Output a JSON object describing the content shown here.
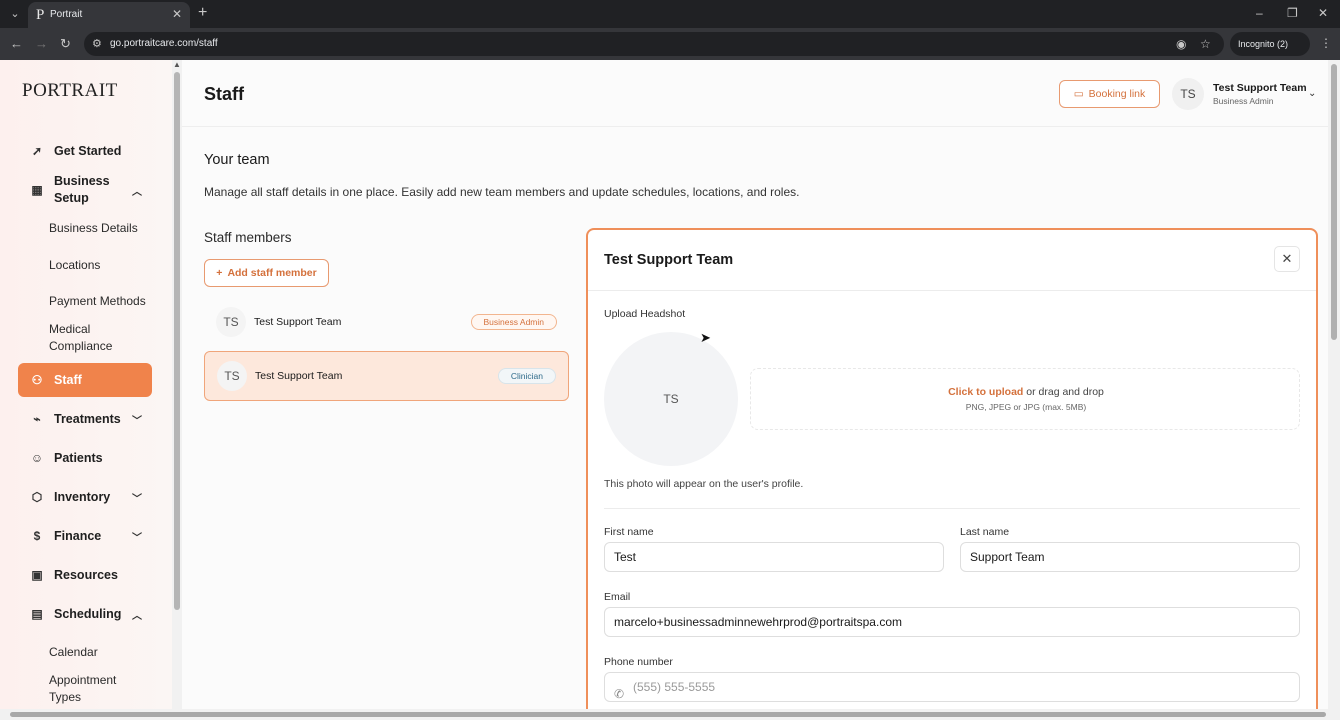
{
  "browser": {
    "tab_title": "Portrait",
    "url": "go.portraitcare.com/staff",
    "incognito_label": "Incognito (2)"
  },
  "sidebar": {
    "logo": "PORTRAIT",
    "items": [
      {
        "label": "Get Started",
        "icon": "rocket-icon"
      },
      {
        "label": "Business Setup",
        "icon": "building-icon",
        "expanded": true
      },
      {
        "label": "Business Details"
      },
      {
        "label": "Locations"
      },
      {
        "label": "Payment Methods"
      },
      {
        "label": "Medical Compliance"
      },
      {
        "label": "Staff",
        "icon": "users-icon",
        "active": true
      },
      {
        "label": "Treatments",
        "icon": "syringe-icon",
        "expanded": false
      },
      {
        "label": "Patients",
        "icon": "person-icon"
      },
      {
        "label": "Inventory",
        "icon": "box-icon",
        "expanded": false
      },
      {
        "label": "Finance",
        "icon": "dollar-icon",
        "expanded": false
      },
      {
        "label": "Resources",
        "icon": "bookmark-icon"
      },
      {
        "label": "Scheduling",
        "icon": "calendar-icon",
        "expanded": true
      },
      {
        "label": "Calendar"
      },
      {
        "label": "Appointment Types"
      }
    ]
  },
  "header": {
    "title": "Staff",
    "booking_link": "Booking link",
    "user_initials": "TS",
    "user_name": "Test Support Team",
    "user_role": "Business Admin"
  },
  "team": {
    "title": "Your team",
    "description": "Manage all staff details in one place. Easily add new team members and update schedules, locations, and roles.",
    "members_title": "Staff members",
    "add_button": "Add staff member",
    "members": [
      {
        "initials": "TS",
        "name": "Test Support Team",
        "role": "Business Admin",
        "selected": false
      },
      {
        "initials": "TS",
        "name": "Test Support Team",
        "role": "Clinician",
        "selected": true
      }
    ]
  },
  "panel": {
    "title": "Test Support Team",
    "upload_label": "Upload Headshot",
    "headshot_initials": "TS",
    "upload_link": "Click to upload",
    "upload_text": " or drag and drop",
    "upload_hint": "PNG, JPEG or JPG (max. 5MB)",
    "photo_note": "This photo will appear on the user's profile.",
    "first_name_label": "First name",
    "first_name": "Test",
    "last_name_label": "Last name",
    "last_name": "Support Team",
    "email_label": "Email",
    "email": "marcelo+businessadminnewehrprod@portraitspa.com",
    "phone_label": "Phone number",
    "phone_placeholder": "(555) 555-5555"
  },
  "colors": {
    "accent": "#f0834b",
    "accent_text": "#d4713c"
  }
}
